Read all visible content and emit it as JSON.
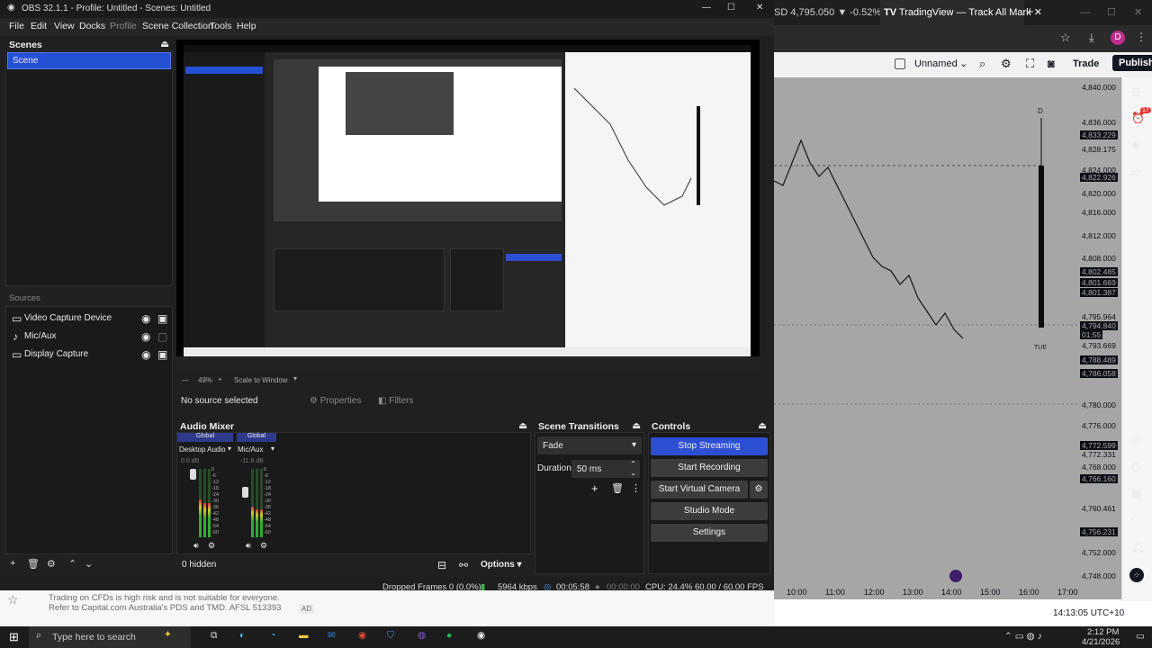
{
  "obs": {
    "title": "OBS 32.1.1 - Profile: Untitled - Scenes: Untitled",
    "menu": [
      "File",
      "Edit",
      "View",
      "Docks",
      "Profile",
      "Scene Collection",
      "Tools",
      "Help"
    ],
    "scenes_title": "Scenes",
    "scene_item": "Scene",
    "sources_title": "Sources",
    "sources": [
      {
        "label": "Video Capture Device",
        "icon": "monitor-icon"
      },
      {
        "label": "Mic/Aux",
        "icon": "mic-icon"
      },
      {
        "label": "Display Capture",
        "icon": "monitor-icon"
      }
    ],
    "sources_hidden": "0 hidden",
    "no_source": "No source selected",
    "properties": "Properties",
    "filters": "Filters",
    "zoom": "49%",
    "scale": "Scale to Window",
    "audio_mixer": {
      "title": "Audio Mixer",
      "channels": [
        {
          "tag": "Global",
          "name": "Desktop Audio",
          "db": "0.0 dB",
          "level": 0.55
        },
        {
          "tag": "Global",
          "name": "Mic/Aux",
          "db": "-11.8 dB",
          "level": 0.45
        }
      ],
      "scale": [
        "0",
        "-6",
        "-12",
        "-18",
        "-24",
        "-30",
        "-36",
        "-42",
        "-48",
        "-54",
        "-60"
      ],
      "options": "Options"
    },
    "transitions": {
      "title": "Scene Transitions",
      "type": "Fade",
      "duration_label": "Duration",
      "duration": "50 ms"
    },
    "controls": {
      "title": "Controls",
      "stop_streaming": "Stop Streaming",
      "start_recording": "Start Recording",
      "virtual_camera": "Start Virtual Camera",
      "studio_mode": "Studio Mode",
      "settings": "Settings"
    },
    "status": {
      "dropped": "Dropped Frames 0 (0.0%)",
      "kbps": "5964 kbps",
      "stream_time": "00:05:58",
      "rec_time": "00:00:00",
      "cpu": "CPU: 24.4%",
      "fps": "60.00 / 60.00 FPS"
    }
  },
  "browser": {
    "tab1": "SD 4,795.050 ▼ -0.52% |",
    "tab2": "TradingView — Track All Mark",
    "avatar": "D",
    "layout": "Unnamed",
    "trade": "Trade",
    "publish": "Publish",
    "price_labels": [
      "4,840.000",
      "4,836.000",
      "4,833.229",
      "4,828.175",
      "4,824.000",
      "4,822.926",
      "4,820.000",
      "4,816.000",
      "4,812.000",
      "4,808.000",
      "4,802.485",
      "4,801.669",
      "4,801.387",
      "4,795.964",
      "4,794.840",
      "01:55",
      "4,793.669",
      "4,788.489",
      "4,786.058",
      "4,780.000",
      "4,776.000",
      "4,772.599",
      "4,772.331",
      "4,768.000",
      "4,766.160",
      "4,760.461",
      "4,756.231",
      "4,752.000",
      "4,748.000"
    ],
    "time_labels": [
      "10:00",
      "11:00",
      "12:00",
      "13:00",
      "14:00",
      "15:00",
      "16:00",
      "17:00"
    ],
    "chart_marks": [
      "D",
      "TUE"
    ],
    "clock": "14:13:05 UTC+10",
    "notifications": "17",
    "disclaimer": "Trading on CFDs is high risk and is not suitable for everyone. Refer to Capital.com Australia's PDS and TMD. AFSL 513393",
    "ad": "AD"
  },
  "taskbar": {
    "search": "Type here to search",
    "time": "2:12 PM",
    "date": "4/21/2026"
  }
}
